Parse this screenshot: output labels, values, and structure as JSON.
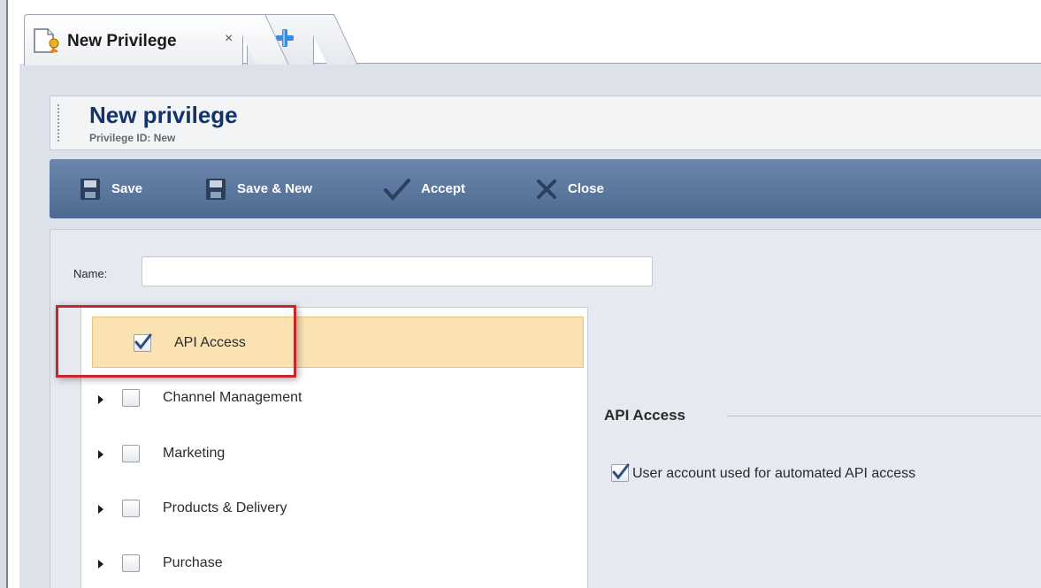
{
  "tabs": {
    "active": {
      "label": "New Privilege",
      "close": "×",
      "icon": "document-privilege-icon"
    },
    "add": {
      "icon": "plus-icon"
    }
  },
  "header": {
    "title": "New privilege",
    "subtitle": "Privilege ID:  New"
  },
  "toolbar": {
    "save": "Save",
    "save_new": "Save & New",
    "accept": "Accept",
    "close": "Close"
  },
  "form": {
    "name_label": "Name:",
    "name_value": "",
    "name_placeholder": ""
  },
  "tree": [
    {
      "label": "API Access",
      "checked": true,
      "expandable": false,
      "selected": true
    },
    {
      "label": "Channel Management",
      "checked": false,
      "expandable": true,
      "selected": false
    },
    {
      "label": "Marketing",
      "checked": false,
      "expandable": true,
      "selected": false
    },
    {
      "label": "Products & Delivery",
      "checked": false,
      "expandable": true,
      "selected": false
    },
    {
      "label": "Purchase",
      "checked": false,
      "expandable": true,
      "selected": false
    }
  ],
  "detail": {
    "heading": "API Access",
    "checkbox_label": "User account used for automated API access",
    "checkbox_checked": true
  },
  "colors": {
    "toolbar": "#5b769c",
    "title": "#12336b",
    "selection": "#fbe2b2",
    "highlight": "#c9252c",
    "accent_plus": "#3b8be0"
  }
}
